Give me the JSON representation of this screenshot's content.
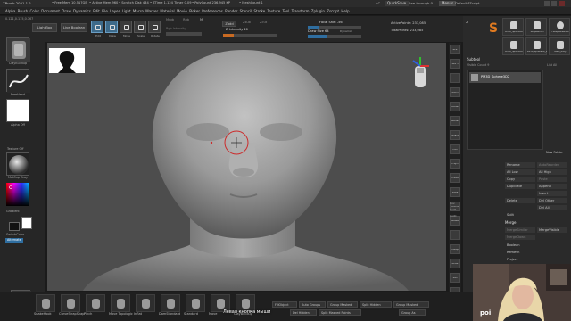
{
  "title_bar": {
    "app_title": "ZBrush 2021.1.2 - ...",
    "stats": [
      "• Free Mem 10,517GB",
      "• Active Mem 960",
      "• Scratch Disk 434",
      "• ZTime 1.124 Timer 0.09",
      "• PolyCount 236,945 KP",
      "• MeshCount 1"
    ],
    "ac_label": "AC",
    "quicksave_label": "QuickSave",
    "see_through_label": "See-through 0",
    "menus_label": "Menus",
    "default_script_label": "DefaultZScript"
  },
  "menu_bar": {
    "items": [
      "Alpha",
      "Brush",
      "Color",
      "Document",
      "Draw",
      "Dynamics",
      "Edit",
      "File",
      "Layer",
      "Light",
      "Macro",
      "Marker",
      "Material",
      "Movie",
      "Picker",
      "Preferences",
      "Render",
      "Stencil",
      "Stroke",
      "Texture",
      "Tool",
      "Transform",
      "Zplugin",
      "Zscript",
      "Help"
    ]
  },
  "shelf": {
    "coords_label": "0.121,0.115,0.767",
    "lightbox_label": "LightBox",
    "live_boolean_label": "Live Boolean",
    "tools": [
      {
        "label": "Edit",
        "active": true
      },
      {
        "label": "Draw",
        "active": true
      },
      {
        "label": "Move",
        "active": false
      },
      {
        "label": "Scale",
        "active": false
      },
      {
        "label": "Rotate",
        "active": false
      }
    ],
    "mrgb_label": "Mrgb",
    "rgb_label": "Rgb",
    "m_label": "M",
    "zadd_label": "Zadd",
    "zsub_label": "Zsub",
    "zcut_label": "Zcut",
    "rgb_intensity_label": "Rgb Intensity",
    "z_intensity_label": "Z Intensity 20",
    "z_intensity_value": 0.2,
    "focal_shift_label": "Focal Shift -56",
    "focal_shift_value": 0.22,
    "draw_size_label": "Draw Size 64",
    "draw_size_value": 0.35,
    "dynamic_label": "Dynamic",
    "active_points_label": "ActivePoints: 233,085",
    "total_points_label": "TotalPoints: 233,085"
  },
  "left_tray": {
    "brush_name": "ClayBuildup",
    "stroke_name": "FreeHand",
    "alpha_name": "Alpha Off",
    "texture_name": "Texture Off",
    "material_name": "MatCap Gray",
    "gradient_label": "Gradient",
    "switch_color_label": "SwitchColor",
    "alternate_label": "Alternate",
    "bottom_brush_label": "ClayBuildup"
  },
  "right_strip": {
    "buttons": [
      {
        "label": "BPR",
        "on": false
      },
      {
        "label": "SPix 3",
        "on": false
      },
      {
        "label": "Scroll",
        "on": false
      },
      {
        "label": "Zoom",
        "on": false
      },
      {
        "label": "Actual",
        "on": false
      },
      {
        "label": "AAHalf",
        "on": false
      },
      {
        "label": "Dynamic Persp",
        "on": false
      },
      {
        "label": "Floor",
        "on": false
      },
      {
        "label": "L.Sym",
        "on": false
      },
      {
        "label": "Frame",
        "on": false
      },
      {
        "label": "Move",
        "on": false
      },
      {
        "label": "Zoom3D",
        "on": false
      },
      {
        "label": "Rotate",
        "on": false
      },
      {
        "label": "Line Fill PolyF",
        "on": false
      },
      {
        "label": "Transp",
        "on": false
      },
      {
        "label": "Ghost",
        "on": false
      },
      {
        "label": "Solo",
        "on": false
      },
      {
        "label": "Xpose",
        "on": false
      }
    ],
    "side_buttons": [
      "Clear Zr",
      "Mirror",
      "Double",
      "Flip"
    ],
    "side_prefix": [
      "Cov",
      "CorT",
      "CorD"
    ]
  },
  "right_panel": {
    "top_tools": [
      {
        "label": "PM3D_Sphere3D"
      },
      {
        "label": "SimpleBrush"
      },
      {
        "label": "TSBSphereBrush"
      },
      {
        "label": "PM3D_Sphere3D"
      },
      {
        "label": "PM3D_Sphere3D_1"
      },
      {
        "label": "Babo_body"
      }
    ],
    "counter": "2",
    "subtool_header": "Subtool",
    "visible_count_label": "Visible Count 9",
    "active_subtool": "PM3D_Sphere3D2",
    "list_all_label": "List All",
    "new_folder_label": "New Folder",
    "rows": [
      {
        "left": "Rename",
        "right": "AutoReorder",
        "dim_right": true
      },
      {
        "left": "All Low",
        "right": "All High",
        "dim_right": false
      },
      {
        "left": "Copy",
        "right": "Paste",
        "dim_right": true
      },
      {
        "left": "Duplicate",
        "right": "Append",
        "dim_right": false
      },
      {
        "left": "",
        "right": "Insert",
        "dim_right": false
      },
      {
        "left": "Delete",
        "right": "Del Other",
        "dim_right": false
      },
      {
        "left": "",
        "right": "Del All",
        "dim_right": false
      }
    ],
    "split_label": "Split",
    "merge_header": "Merge",
    "merge_rows": [
      {
        "left": "MergeSimilar",
        "right": "MergeVisible",
        "dim_left": true
      },
      {
        "left": "MergeDown",
        "right": "",
        "dim_left": true
      }
    ],
    "extra_labels": [
      "Boolean",
      "Remesh",
      "Project"
    ]
  },
  "bottom_bar": {
    "brushes": [
      "SnakeHook",
      "CurveStrapSnap",
      "Pinch",
      "Move Topologic",
      "Inflat",
      "DamStandard",
      "Standard",
      "Move",
      "ClayBuildup"
    ],
    "fill_object_label": "FillObject",
    "auto_groups_label": "Auto Groups",
    "group_masked_label": "Group Masked",
    "split_hidden_label": "Split Hidden",
    "group_masked2_label": "Group Masked",
    "del_hidden_label": "Del Hidden",
    "split_masked_label": "Split Masked Points",
    "group_as_label": "Group As"
  },
  "subtitle": "Левая кнопка мыши",
  "watermark": "poi"
}
